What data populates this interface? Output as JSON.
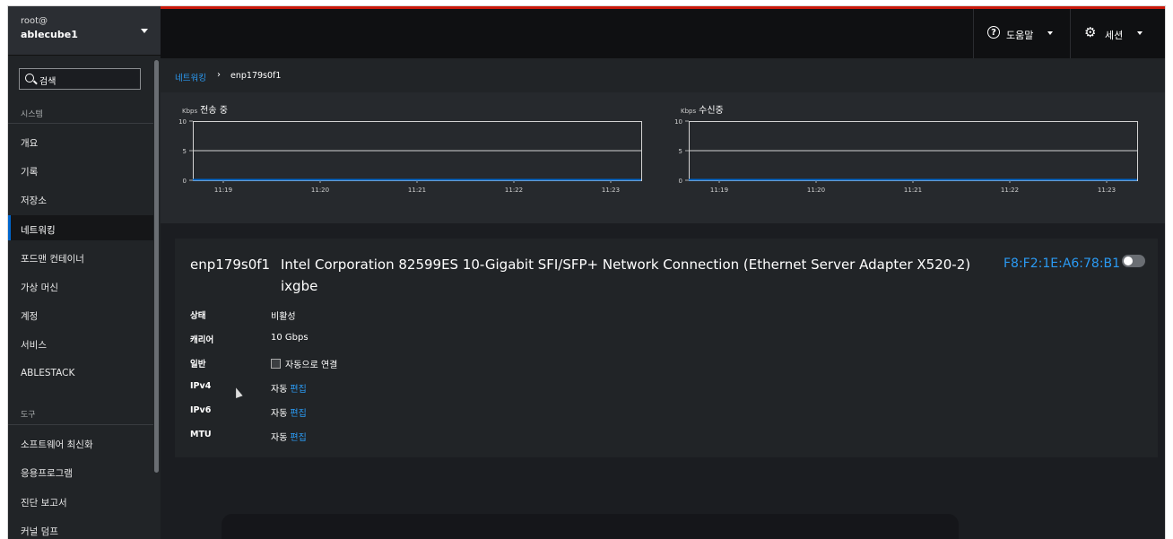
{
  "host": {
    "user": "root@",
    "name": "ablecube1"
  },
  "search": {
    "placeholder": "검색"
  },
  "sidebar": {
    "section_system": "시스템",
    "system_items": [
      "개요",
      "기록",
      "저장소",
      "네트워킹",
      "포드맨 컨테이너",
      "가상 머신",
      "계정",
      "서비스",
      "ABLESTACK"
    ],
    "active_index": 3,
    "section_tools": "도구",
    "tool_items": [
      "소프트웨어 최신화",
      "응용프로그램",
      "진단 보고서",
      "커널 덤프"
    ]
  },
  "topbar": {
    "help": "도움말",
    "session": "세션"
  },
  "breadcrumb": {
    "parent": "네트워킹",
    "separator": "›",
    "current": "enp179s0f1"
  },
  "graphs": [
    {
      "unit": "Kbps",
      "title": "전송 중"
    },
    {
      "unit": "Kbps",
      "title": "수신중"
    }
  ],
  "chart_data": [
    {
      "type": "line",
      "title": "전송 중",
      "ylabel": "Kbps",
      "x": [
        "11:19",
        "11:20",
        "11:21",
        "11:22",
        "11:23"
      ],
      "yticks": [
        "10",
        "5",
        "0"
      ],
      "ylim": [
        0,
        10
      ],
      "series": [
        {
          "values": [
            0,
            0,
            0,
            0,
            0
          ]
        }
      ],
      "grid": true
    },
    {
      "type": "line",
      "title": "수신중",
      "ylabel": "Kbps",
      "x": [
        "11:19",
        "11:20",
        "11:21",
        "11:22",
        "11:23"
      ],
      "yticks": [
        "10",
        "5",
        "0"
      ],
      "ylim": [
        0,
        10
      ],
      "series": [
        {
          "values": [
            0,
            0,
            0,
            0,
            0
          ]
        }
      ],
      "grid": true
    }
  ],
  "interface": {
    "name": "enp179s0f1",
    "description": "Intel Corporation 82599ES 10-Gigabit SFI/SFP+ Network Connection (Ethernet Server Adapter X520-2)",
    "driver": "ixgbe",
    "mac": "F8:F2:1E:A6:78:B1",
    "enabled": false,
    "rows": {
      "status": {
        "label": "상태",
        "value": "비활성"
      },
      "carrier": {
        "label": "캐리어",
        "value": "10 Gbps"
      },
      "general": {
        "label": "일반",
        "value": "자동으로 연결"
      },
      "ipv4": {
        "label": "IPv4",
        "value": "자동",
        "edit": "편집"
      },
      "ipv6": {
        "label": "IPv6",
        "value": "자동",
        "edit": "편집"
      },
      "mtu": {
        "label": "MTU",
        "value": "자동",
        "edit": "편집"
      }
    }
  },
  "colors": {
    "accent": "#2b9af3",
    "topbar_stripe": "#c9190b",
    "series_line": "#0066cc"
  }
}
